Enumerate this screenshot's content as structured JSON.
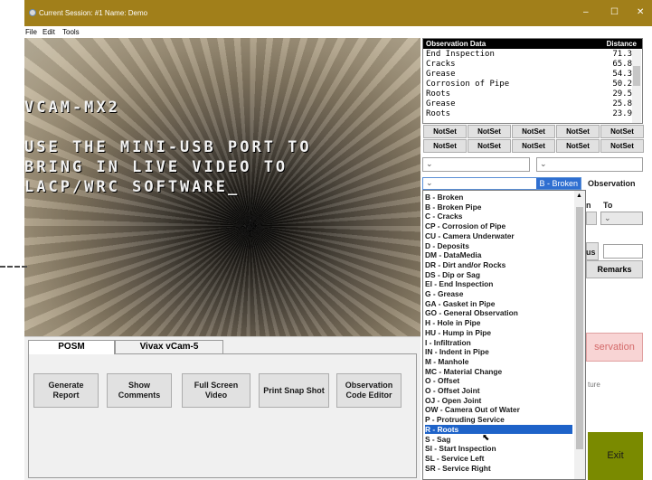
{
  "window": {
    "title": "Current Session: #1 Name: Demo",
    "minimize": "–",
    "maximize": "☐",
    "close": "✕"
  },
  "menu": [
    "File",
    "Edit",
    "Tools"
  ],
  "video": {
    "osd_lines": [
      "VCAM-MX2",
      "USE THE MINI-USB PORT TO",
      "BRING IN LIVE VIDEO TO",
      "LACP/WRC SOFTWARE_"
    ]
  },
  "tabs": [
    "POSM",
    "Vivax vCam-5"
  ],
  "buttons": [
    {
      "line1": "Generate",
      "line2": "Report"
    },
    {
      "line1": "Show",
      "line2": "Comments"
    },
    {
      "line1": "Full Screen",
      "line2": "Video"
    },
    {
      "line1": "Print Snap Shot",
      "line2": ""
    },
    {
      "line1": "Observation",
      "line2": "Code Editor"
    }
  ],
  "observation_data": {
    "header_left": "Observation Data",
    "header_right": "Distance",
    "rows": [
      {
        "name": "End Inspection",
        "distance": "71.3"
      },
      {
        "name": "Cracks",
        "distance": "65.8"
      },
      {
        "name": "Grease",
        "distance": "54.3"
      },
      {
        "name": "Corrosion of Pipe",
        "distance": "50.2"
      },
      {
        "name": "Roots",
        "distance": "29.5"
      },
      {
        "name": "Grease",
        "distance": "25.8"
      },
      {
        "name": "Roots",
        "distance": "23.9"
      }
    ]
  },
  "notset_label": "NotSet",
  "dropdown": {
    "selected": "B - Broken",
    "observation_label": "Observation",
    "items": [
      "B - Broken",
      "B - Broken Pipe",
      "C - Cracks",
      "CP - Corrosion of Pipe",
      "CU - Camera Underwater",
      "D - Deposits",
      "DM - DataMedia",
      "DR - Dirt and/or Rocks",
      "DS - Dip or Sag",
      "EI - End Inspection",
      "G - Grease",
      "GA - Gasket in Pipe",
      "GO - General Observation",
      "H - Hole in Pipe",
      "HU - Hump in Pipe",
      "I - Infiltration",
      "IN - Indent in Pipe",
      "M - Manhole",
      "MC - Material Change",
      "O - Offset",
      "O - Offset Joint",
      "OJ - Open Joint",
      "OW - Camera Out of Water",
      "P - Protruding Service",
      "R - Roots",
      "S - Sag",
      "SI - Start Inspection",
      "SL - Service Left",
      "SR - Service Right"
    ],
    "highlighted_index": 24
  },
  "right_panel": {
    "partial_n": "n",
    "to_label": "To",
    "partial_us": "us",
    "remarks": "Remarks",
    "observation_button": "servation",
    "partial_ture": "ture",
    "exit": "Exit"
  }
}
